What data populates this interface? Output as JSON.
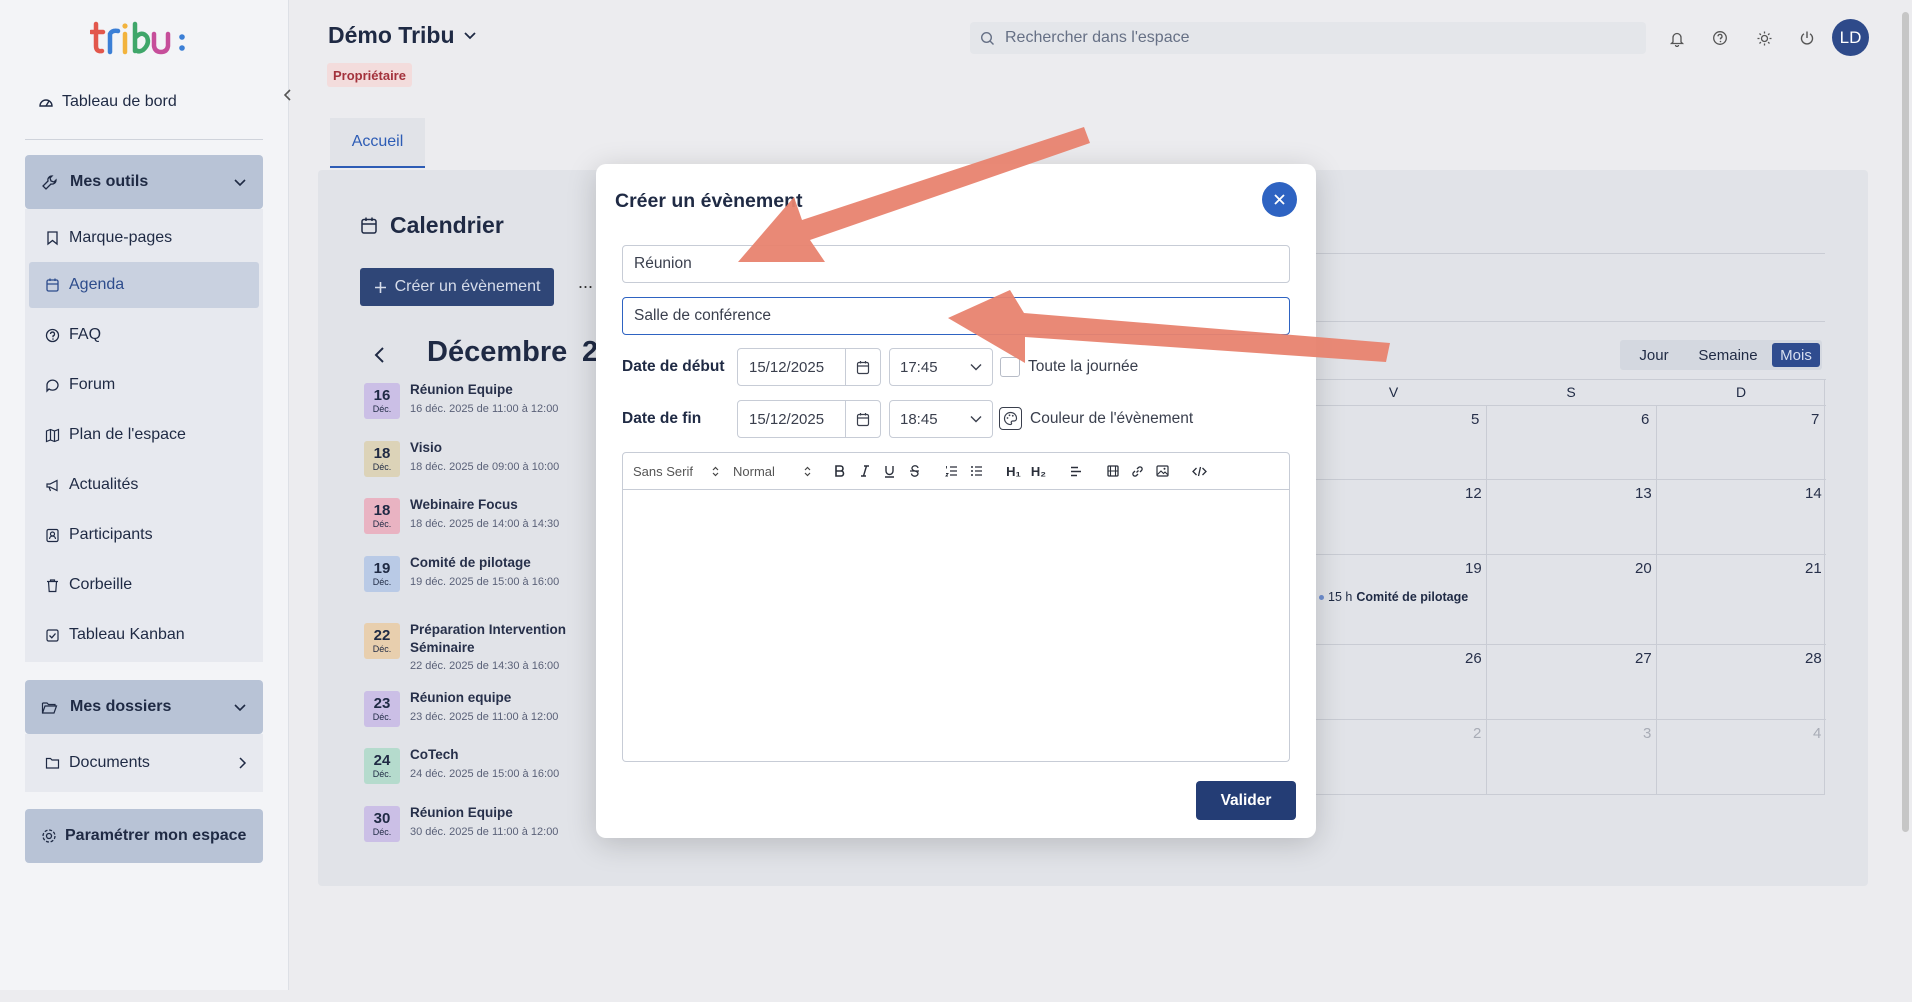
{
  "app": {
    "logo_text": "tribu:",
    "space_title": "Démo Tribu",
    "role_badge": "Propriétaire",
    "user_initials": "LD"
  },
  "search": {
    "placeholder": "Rechercher dans l'espace"
  },
  "sidebar": {
    "dashboard": "Tableau de bord",
    "tools_group": "Mes outils",
    "tools": [
      {
        "label": "Marque-pages",
        "icon": "bookmark-icon"
      },
      {
        "label": "Agenda",
        "icon": "calendar-icon",
        "active": true
      },
      {
        "label": "FAQ",
        "icon": "help-icon"
      },
      {
        "label": "Forum",
        "icon": "forum-icon"
      },
      {
        "label": "Plan de l'espace",
        "icon": "map-icon"
      },
      {
        "label": "Actualités",
        "icon": "megaphone-icon"
      },
      {
        "label": "Participants",
        "icon": "contacts-icon"
      },
      {
        "label": "Corbeille",
        "icon": "trash-icon"
      },
      {
        "label": "Tableau Kanban",
        "icon": "checkbox-icon"
      }
    ],
    "folders_group": "Mes dossiers",
    "documents": "Documents",
    "settings_button": "Paramétrer mon espace"
  },
  "tabs": {
    "home": "Accueil"
  },
  "calendar": {
    "title": "Calendrier",
    "create_button": "Créer un évènement",
    "more": "...",
    "month": "Décembre",
    "year_partial": "2",
    "views": {
      "day": "Jour",
      "week": "Semaine",
      "month": "Mois"
    },
    "weekday_headers": [
      "V",
      "S",
      "D"
    ],
    "grid_rows": [
      [
        "5",
        "6",
        "7"
      ],
      [
        "12",
        "13",
        "14"
      ],
      [
        "19",
        "20",
        "21"
      ],
      [
        "26",
        "27",
        "28"
      ],
      [
        "2",
        "3",
        "4"
      ]
    ],
    "grid_event": {
      "time": "15 h",
      "title": "Comité de pilotage"
    },
    "events": [
      {
        "day": "16",
        "month": "Déc.",
        "title": "Réunion Equipe",
        "subtitle": "16 déc. 2025 de 11:00 à 12:00",
        "color": "#cbbfe6"
      },
      {
        "day": "18",
        "month": "Déc.",
        "title": "Visio",
        "subtitle": "18 déc. 2025 de 09:00 à 10:00",
        "color": "#dcd3b8"
      },
      {
        "day": "18",
        "month": "Déc.",
        "title": "Webinaire Focus",
        "subtitle": "18 déc. 2025 de 14:00 à 14:30",
        "color": "#e9b3c2"
      },
      {
        "day": "19",
        "month": "Déc.",
        "title": "Comité de pilotage",
        "subtitle": "19 déc. 2025 de 15:00 à 16:00",
        "color": "#b9cae6"
      },
      {
        "day": "22",
        "month": "Déc.",
        "title": "Préparation Intervention Séminaire",
        "subtitle": "22 déc. 2025 de 14:30 à 16:00",
        "color": "#e8cfae"
      },
      {
        "day": "23",
        "month": "Déc.",
        "title": "Réunion equipe",
        "subtitle": "23 déc. 2025 de 11:00 à 12:00",
        "color": "#cbbfe6"
      },
      {
        "day": "24",
        "month": "Déc.",
        "title": "CoTech",
        "subtitle": "24 déc. 2025 de 15:00 à 16:00",
        "color": "#b5dbcd"
      },
      {
        "day": "30",
        "month": "Déc.",
        "title": "Réunion Equipe",
        "subtitle": "30 déc. 2025 de 11:00 à 12:00",
        "color": "#cbbfe6"
      }
    ]
  },
  "modal": {
    "title": "Créer un évènement",
    "title_value": "Réunion",
    "location_value": "Salle de conférence",
    "start_label": "Date de début",
    "end_label": "Date de fin",
    "start_date": "15/12/2025",
    "start_time": "17:45",
    "end_date": "15/12/2025",
    "end_time": "18:45",
    "all_day_label": "Toute la journée",
    "color_label": "Couleur de l'évènement",
    "toolbar": {
      "font": "Sans Serif",
      "size": "Normal",
      "h1": "H₁",
      "h2": "H₂"
    },
    "submit": "Valider"
  },
  "colors": {
    "primary": "#2f4677",
    "accent": "#2e63c2",
    "arrow": "#e8836f"
  }
}
